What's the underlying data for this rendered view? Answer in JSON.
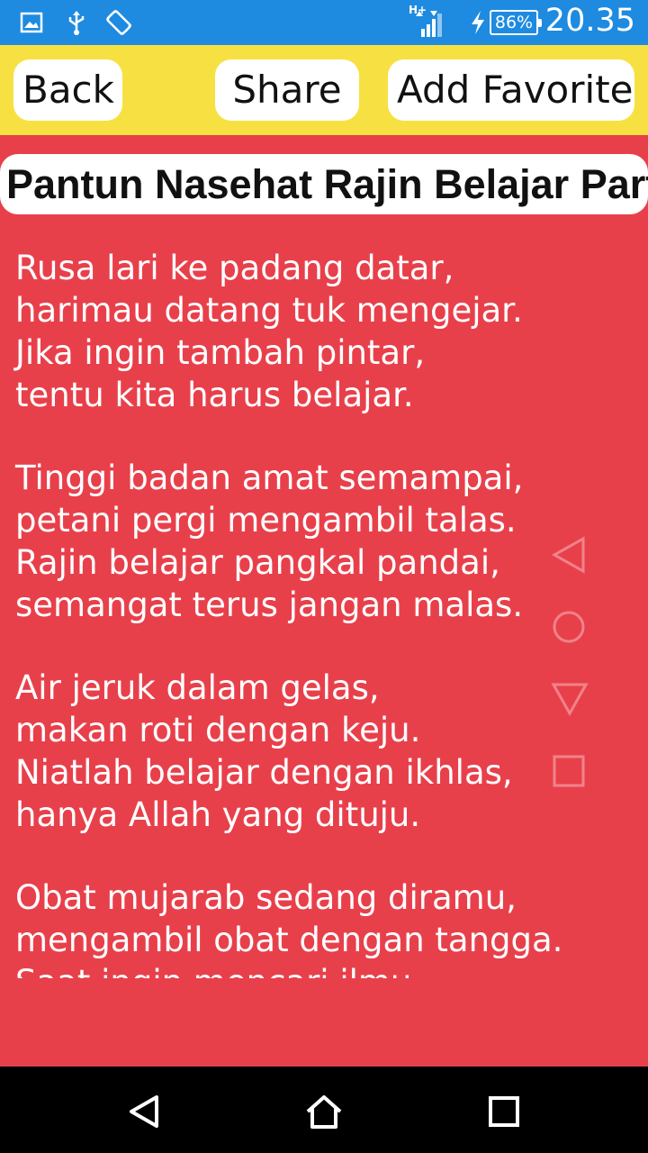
{
  "status_bar": {
    "time": "20.35",
    "battery": "86%",
    "network": "H+",
    "icons": [
      "gallery-icon",
      "usb-icon",
      "rotate-icon",
      "signal-icon",
      "charging-icon",
      "battery-icon"
    ]
  },
  "toolbar": {
    "back_label": "Back",
    "share_label": "Share",
    "favorite_label": "Add Favorite"
  },
  "page": {
    "title": "Pantun Nasehat Rajin Belajar Part"
  },
  "content": {
    "stanzas": [
      {
        "lines": [
          "Rusa lari ke padang datar,",
          "harimau datang tuk mengejar.",
          "Jika ingin tambah pintar,",
          "tentu kita harus belajar."
        ]
      },
      {
        "lines": [
          "Tinggi badan amat semampai,",
          "petani pergi mengambil talas.",
          "Rajin belajar pangkal pandai,",
          "semangat terus jangan malas."
        ]
      },
      {
        "lines": [
          "Air jeruk dalam gelas,",
          "makan roti dengan keju.",
          "Niatlah belajar dengan ikhlas,",
          "hanya Allah yang dituju."
        ]
      },
      {
        "lines": [
          "Obat mujarab sedang diramu,",
          "mengambil obat dengan tangga.",
          "Saat ingin mencari ilmu,"
        ]
      }
    ]
  },
  "colors": {
    "status_bar": "#1e8be0",
    "toolbar": "#f7e142",
    "background": "#e8404b",
    "nav_bar": "#000000"
  }
}
